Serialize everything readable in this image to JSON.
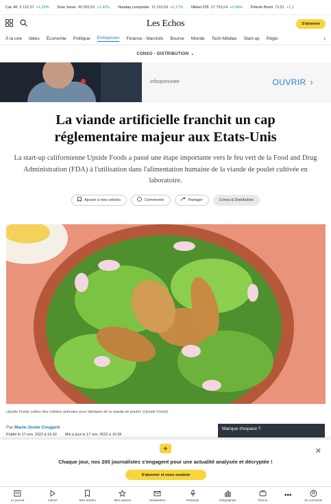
{
  "ticker": [
    {
      "name": "Cac 40",
      "value": "5 122,57",
      "change": "+1,25%"
    },
    {
      "name": "Dow Jones",
      "value": "40 555,52",
      "change": "+1,42%"
    },
    {
      "name": "Nasdaq composite",
      "value": "15 153,59",
      "change": "+2,17%"
    },
    {
      "name": "Nikkei 225",
      "value": "27 753,54",
      "change": "+0,49%"
    },
    {
      "name": "Pétrole Brent",
      "value": "73,51",
      "change": "+1,3"
    }
  ],
  "header": {
    "logo": "Les Echos",
    "subscribe": "S'abonner"
  },
  "nav": [
    "À la une",
    "Idées",
    "Économie",
    "Politique",
    "Entreprises",
    "Finance - Marchés",
    "Bourse",
    "Monde",
    "Tech-Médias",
    "Start-up",
    "Régio"
  ],
  "nav_active": "Entreprises",
  "section": "CONSO - DISTRIBUTION",
  "ad": {
    "advertiser": "infooportunee",
    "open_label": "OUVRIR"
  },
  "article": {
    "title": "La viande artificielle franchit un cap réglementaire majeur aux Etats-Unis",
    "lead": "La start-up californienne Upside Foods a passé une étape importante vers le feu vert de la Food and Drug Administration (FDA) à l'utilisation dans l'alimentation humaine de la viande de poulet cultivée en laboratoire.",
    "actions": {
      "save": "Ajouter à mes articles",
      "comment": "Commenter",
      "share": "Partager",
      "tag": "Conso & Distribution"
    },
    "caption": "Upside Foods cultive des cellules animales pour fabriquer de la viande de poulet. (Upside Foods)",
    "byline_prefix": "Par",
    "author": "Marie-Josée Cougard",
    "published": "Publié le 17 nov. 2022 à 15:32",
    "updated": "Mis à jour le 17 nov. 2022 à 15:39",
    "related_thumb": "Manque d'espace ?"
  },
  "overlay": {
    "message": "Chaque jour, nos 200 journalistes s'engagent pour une actualité analysée et décryptée !",
    "cta": "S'abonner et nous soutenir"
  },
  "tabbar": [
    {
      "label": "Le journal",
      "icon": "newspaper-icon"
    },
    {
      "label": "Vidéos",
      "icon": "play-icon"
    },
    {
      "label": "Mes articles",
      "icon": "bookmark-icon"
    },
    {
      "label": "Mes auteurs",
      "icon": "star-icon"
    },
    {
      "label": "Newsletters",
      "icon": "envelope-icon"
    },
    {
      "label": "Podcasts",
      "icon": "microphone-icon"
    },
    {
      "label": "Infographies",
      "icon": "bar-chart-icon"
    },
    {
      "label": "Thema",
      "icon": "folder-icon"
    },
    {
      "label": "Se connecter",
      "icon": "user-icon"
    }
  ],
  "colors": {
    "accent": "#1a7bb8",
    "brand_yellow": "#f7d53e",
    "positive": "#1f9d55"
  }
}
